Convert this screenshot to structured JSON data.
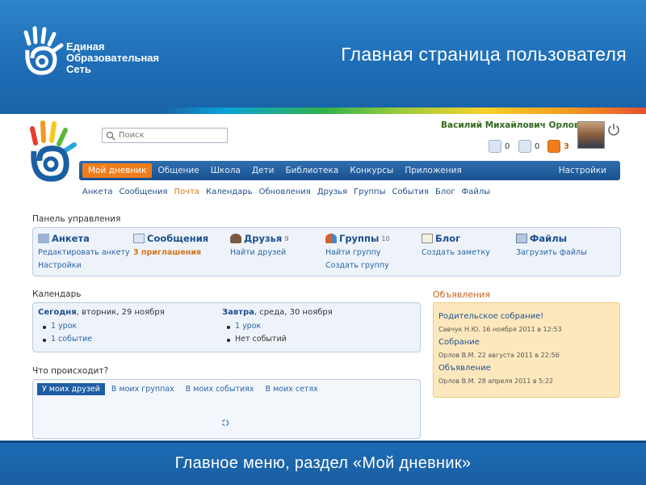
{
  "slide": {
    "title": "Главная страница пользователя",
    "caption": "Главное меню, раздел «Мой дневник»",
    "logo_lines": [
      "Единая",
      "Образовательная",
      "Сеть"
    ]
  },
  "site": {
    "search_placeholder": "Поиск",
    "user_name": "Василий Михайлович Орлов",
    "counters": [
      {
        "icon": "envelope-icon",
        "value": "0"
      },
      {
        "icon": "person-icon",
        "value": "0"
      },
      {
        "icon": "group-alert-icon",
        "value": "3"
      }
    ]
  },
  "main_nav": {
    "items": [
      "Мой дневник",
      "Общение",
      "Школа",
      "Дети",
      "Библиотека",
      "Конкурсы",
      "Приложения"
    ],
    "active": "Мой дневник",
    "right": "Настройки"
  },
  "sub_nav": {
    "items": [
      "Анкета",
      "Сообщения",
      "Почта",
      "Календарь",
      "Обновления",
      "Друзья",
      "Группы",
      "События",
      "Блог",
      "Файлы"
    ],
    "active": "Почта"
  },
  "dashboard": {
    "title": "Панель управления",
    "columns": [
      {
        "icon": "card-icon",
        "title": "Анкета",
        "count": "",
        "links": [
          "Редактировать анкету",
          "Настройки"
        ]
      },
      {
        "icon": "envelope-icon",
        "title": "Сообщения",
        "count": "",
        "links": [
          "3 приглашения"
        ]
      },
      {
        "icon": "person-icon",
        "title": "Друзья",
        "count": "9",
        "links": [
          "Найти друзей"
        ]
      },
      {
        "icon": "group-icon",
        "title": "Группы",
        "count": "10",
        "links": [
          "Найти группу",
          "Создать группу"
        ]
      },
      {
        "icon": "pencil-icon",
        "title": "Блог",
        "count": "",
        "links": [
          "Создать заметку"
        ]
      },
      {
        "icon": "folder-icon",
        "title": "Файлы",
        "count": "",
        "links": [
          "Загрузить файлы"
        ]
      }
    ]
  },
  "calendar": {
    "title": "Календарь",
    "today": {
      "label": "Сегодня",
      "date": ", вторник, 29 ноября",
      "items": [
        "1 урок",
        "1 событие"
      ]
    },
    "tomorrow": {
      "label": "Завтра",
      "date": ", среда, 30 ноября",
      "items": [
        "1 урок",
        "Нет событий"
      ]
    }
  },
  "announcements": {
    "title": "Объявления",
    "items": [
      {
        "title": "Родительское собрание!",
        "meta": "Савчук Н.Ю. 16 ноября 2011 в 12:53"
      },
      {
        "title": "Собрание",
        "meta": "Орлов В.М. 22 августа 2011 в 22:56"
      },
      {
        "title": "Объявление",
        "meta": "Орлов В.М. 28 апреля 2011 в 5:22"
      }
    ]
  },
  "activity": {
    "title": "Что происходит?",
    "tabs": [
      "У моих друзей",
      "В моих группах",
      "В моих событиях",
      "В моих сетях"
    ],
    "active": "У моих друзей"
  }
}
